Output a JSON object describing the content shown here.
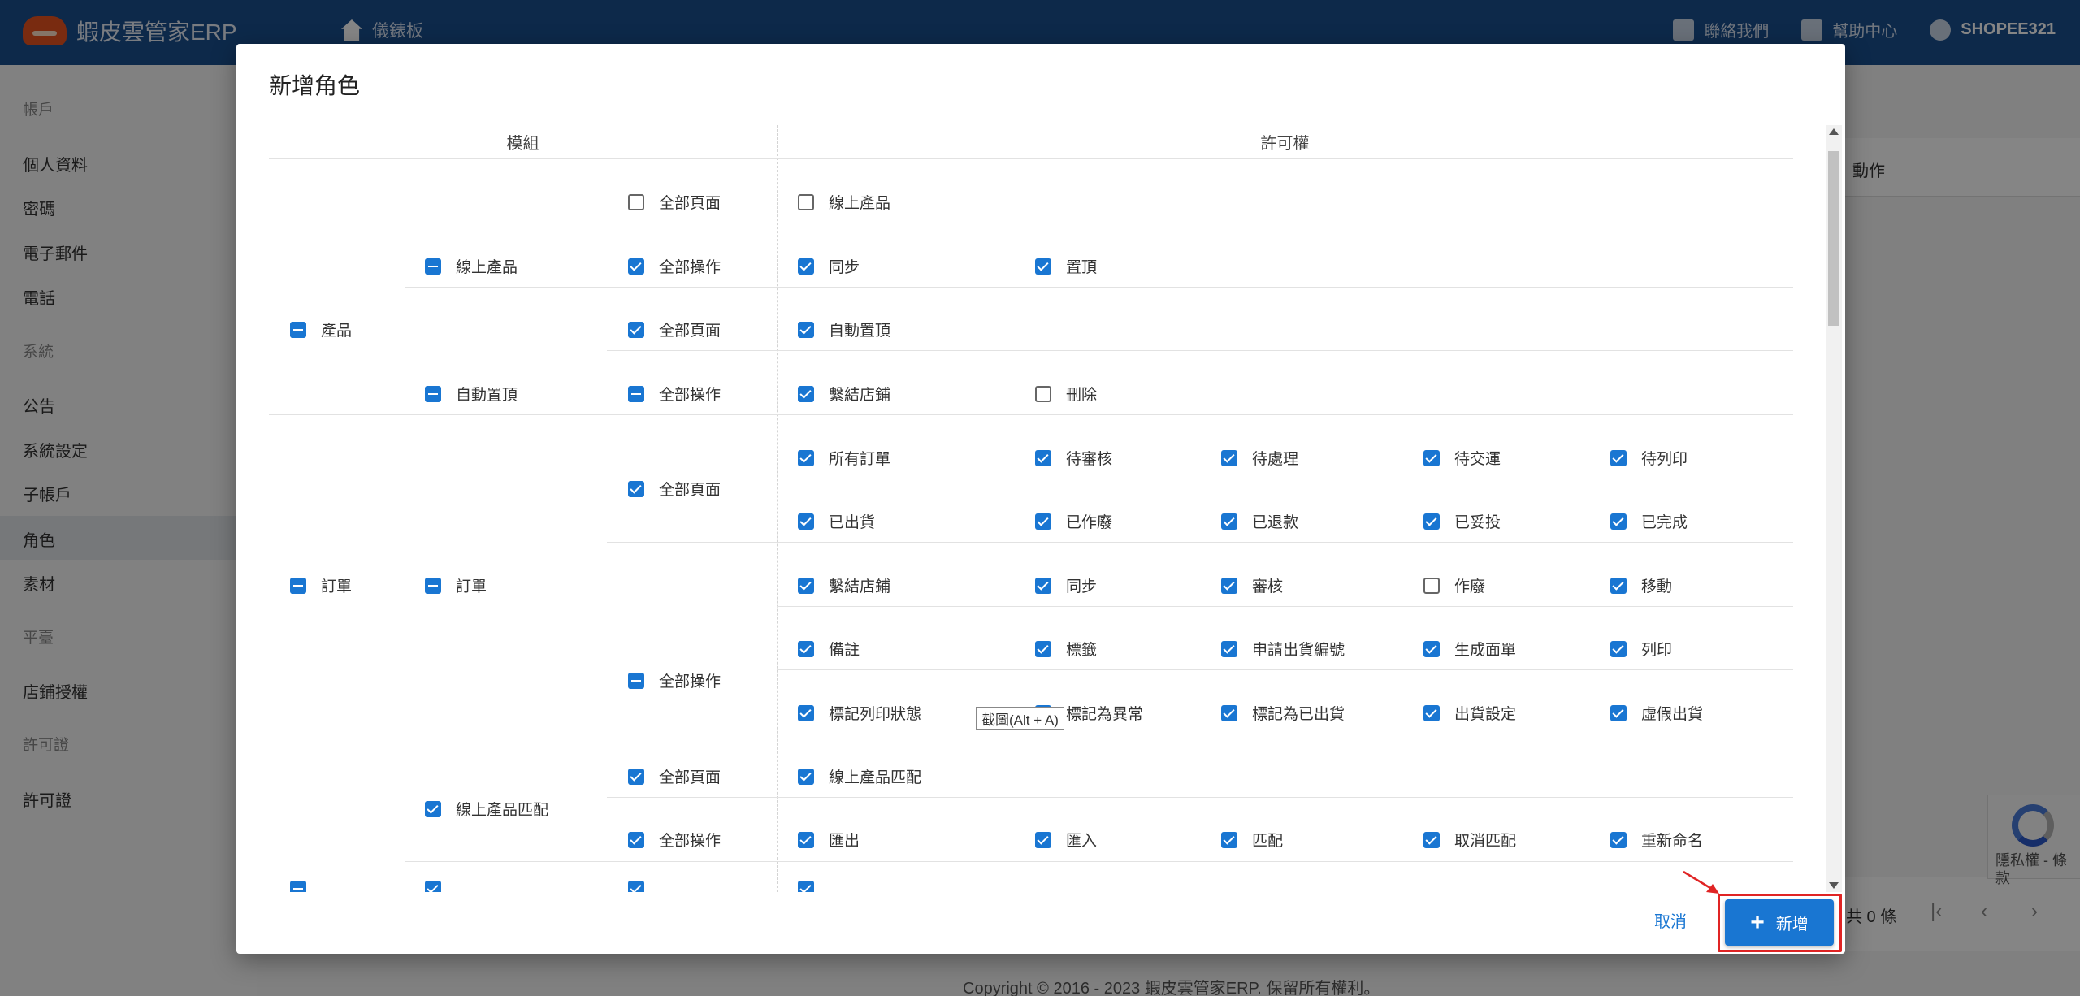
{
  "app": {
    "title": "蝦皮雲管家ERP",
    "nav_dashboard": "儀錶板",
    "contact": "聯絡我們",
    "help": "幫助中心",
    "user": "SHOPEE321"
  },
  "sidebar": {
    "account_section": "帳戶",
    "profile": "個人資料",
    "password": "密碼",
    "email": "電子郵件",
    "phone": "電話",
    "system_section": "系統",
    "announcement": "公告",
    "system_settings": "系統設定",
    "sub_accounts": "子帳戶",
    "roles": "角色",
    "materials": "素材",
    "platform_section": "平臺",
    "store_auth": "店鋪授權",
    "license_section": "許可證",
    "license": "許可證"
  },
  "background": {
    "action_header": "動作",
    "pager_total": "共 0 條",
    "footer": "Copyright © 2016 - 2023 蝦皮雲管家ERP. 保留所有權利。",
    "recaptcha_text": "隱私權 - 條款"
  },
  "dialog": {
    "title": "新增角色",
    "col_module": "模組",
    "col_permission": "許可權",
    "tooltip": "截圖(Alt + A)",
    "cancel": "取消",
    "add": "新增",
    "modules": {
      "product": "產品",
      "online_product": "線上產品",
      "auto_top": "自動置頂",
      "order": "訂單",
      "order_sub": "訂單",
      "online_match": "線上產品匹配"
    },
    "all_pages": "全部頁面",
    "all_actions": "全部操作",
    "perms": {
      "online_product": "線上產品",
      "sync": "同步",
      "pin_top": "置頂",
      "auto_top": "自動置頂",
      "link_store": "繫結店鋪",
      "delete": "刪除",
      "all_orders": "所有訂單",
      "pending_review": "待審核",
      "pending_process": "待處理",
      "pending_ship": "待交運",
      "pending_print": "待列印",
      "shipped": "已出貨",
      "voided": "已作廢",
      "refunded": "已退款",
      "delivered": "已妥投",
      "completed": "已完成",
      "link_store2": "繫結店鋪",
      "sync2": "同步",
      "review": "審核",
      "void": "作廢",
      "move": "移動",
      "note": "備註",
      "tag": "標籤",
      "apply_ship_no": "申請出貨編號",
      "gen_sheet": "生成面單",
      "print": "列印",
      "mark_printed": "標記列印狀態",
      "mark_abnormal": "標記為異常",
      "mark_shipped": "標記為已出貨",
      "ship_settings": "出貨設定",
      "fake_ship": "虛假出貨",
      "online_match": "線上產品匹配",
      "export": "匯出",
      "import": "匯入",
      "match": "匹配",
      "unmatch": "取消匹配",
      "rename": "重新命名"
    }
  },
  "colors": {
    "topbar": "#1a4f8f",
    "primary": "#1976d2",
    "highlight": "#e02424"
  }
}
